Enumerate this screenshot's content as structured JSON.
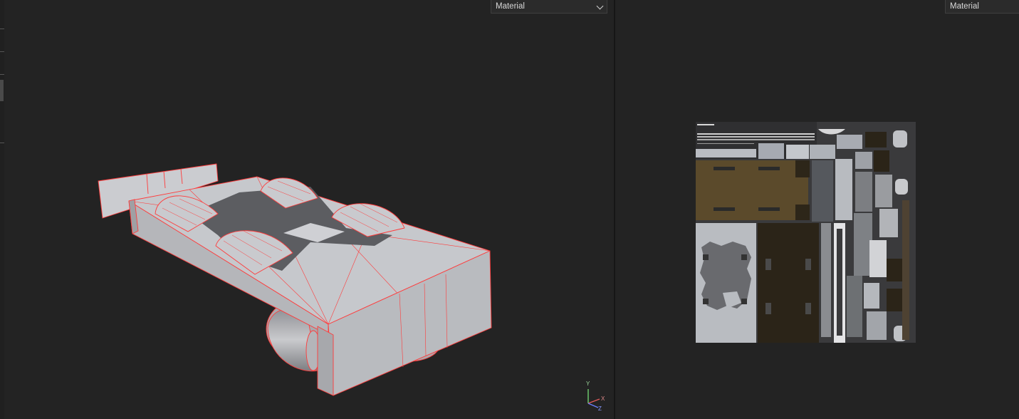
{
  "left_viewport": {
    "shading_mode": "Material",
    "axis_gizmo": {
      "y_label": "Y",
      "x_label": "X",
      "z_label": "Z"
    }
  },
  "right_viewport": {
    "shading_mode": "Material"
  },
  "colors": {
    "background": "#232323",
    "mesh_face": "#c2c4c8",
    "wireframe": "#ff3b3b",
    "uv_dark_panel": "#2b2418",
    "uv_brown_panel": "#5a4a2a"
  }
}
